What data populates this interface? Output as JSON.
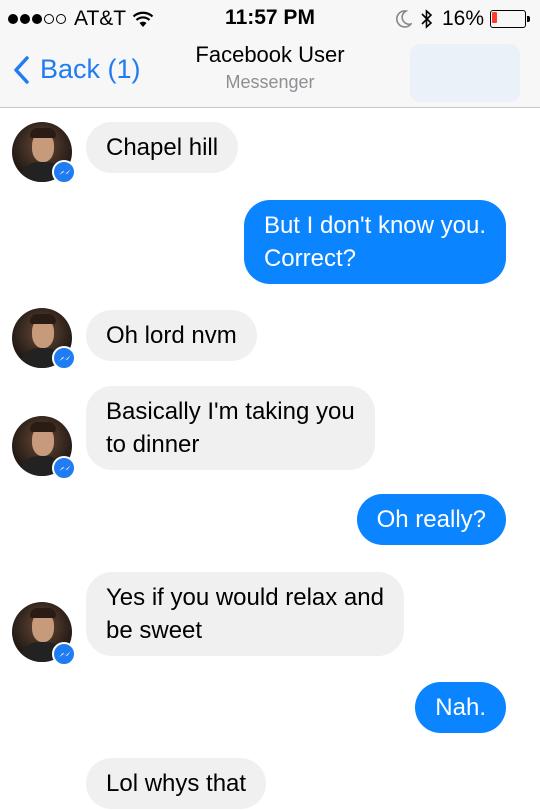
{
  "status_bar": {
    "carrier": "AT&T",
    "time": "11:57 PM",
    "battery": "16%",
    "battery_level": 0.16,
    "signal_bars_filled": 3,
    "signal_bars_total": 5
  },
  "nav": {
    "back_label": "Back (1)",
    "title": "Facebook User",
    "subtitle": "Messenger"
  },
  "colors": {
    "accent": "#1f7cf2",
    "outgoing_bubble": "#0b85ff",
    "incoming_bubble": "#f0f0f0",
    "battery_low": "#ff3b30"
  },
  "messages": [
    {
      "direction": "in",
      "text": "Chapel hill"
    },
    {
      "direction": "out",
      "text": "But I don't know you.\nCorrect?"
    },
    {
      "direction": "in",
      "text": "Oh lord nvm"
    },
    {
      "direction": "in",
      "text": "Basically I'm taking you\nto dinner"
    },
    {
      "direction": "out",
      "text": "Oh really?"
    },
    {
      "direction": "in",
      "text": "Yes if you would relax and\nbe sweet"
    },
    {
      "direction": "out",
      "text": "Nah."
    },
    {
      "direction": "in",
      "text": "Lol whys that"
    }
  ]
}
